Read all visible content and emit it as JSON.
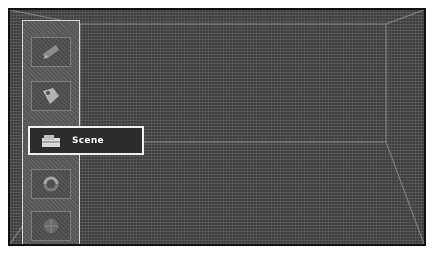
{
  "menu": {
    "items": [
      {
        "name": "pen-icon",
        "selected": false
      },
      {
        "name": "tag-icon",
        "selected": false
      },
      {
        "name": "scene-icon",
        "selected": true,
        "label": "Scene"
      },
      {
        "name": "refresh-icon",
        "selected": false
      },
      {
        "name": "globe-icon",
        "selected": false
      }
    ]
  },
  "selected_item": {
    "label": "Scene"
  }
}
